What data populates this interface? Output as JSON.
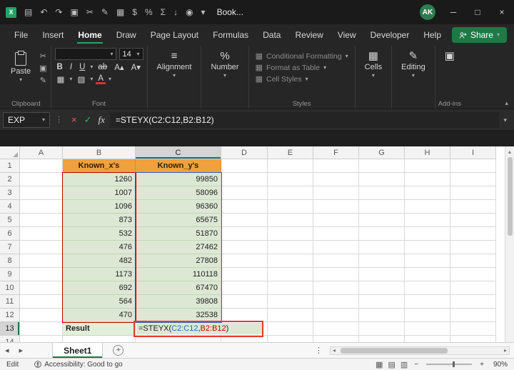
{
  "glyphs": {
    "chevron_down": "▾",
    "chevron_up": "▴"
  },
  "colors": {
    "excel_green": "#21a366",
    "header_orange": "#f0a03e",
    "cell_green": "#dce8d4",
    "result_green": "#e2efda",
    "annotation_red": "#e8392e",
    "range_blue": "#2a66c8",
    "range_red": "#c00000"
  },
  "titlebar": {
    "title": "Book...",
    "avatar_initials": "AK",
    "icons": [
      {
        "name": "excel-icon",
        "glyph": "X",
        "accent": true
      },
      {
        "name": "save-icon",
        "glyph": "▤"
      },
      {
        "name": "undo-icon",
        "glyph": "↶"
      },
      {
        "name": "redo-icon",
        "glyph": "↷"
      },
      {
        "name": "copy-icon",
        "glyph": "▣"
      },
      {
        "name": "cut-icon",
        "glyph": "✂"
      },
      {
        "name": "format-painter-icon",
        "glyph": "✎"
      },
      {
        "name": "merge-center-icon",
        "glyph": "▦"
      },
      {
        "name": "dollar-icon",
        "glyph": "$"
      },
      {
        "name": "percent-icon",
        "glyph": "%"
      },
      {
        "name": "autosum-icon",
        "glyph": "Σ"
      },
      {
        "name": "sort-icon",
        "glyph": "↓"
      },
      {
        "name": "record-macro-icon",
        "glyph": "◉"
      },
      {
        "name": "customize-quick-access-icon",
        "glyph": "▾"
      }
    ],
    "window_controls": {
      "minimize": "─",
      "maximize": "□",
      "close": "×"
    }
  },
  "menu": {
    "tabs": [
      {
        "label": "File"
      },
      {
        "label": "Insert"
      },
      {
        "label": "Home",
        "active": true
      },
      {
        "label": "Draw"
      },
      {
        "label": "Page Layout"
      },
      {
        "label": "Formulas"
      },
      {
        "label": "Data"
      },
      {
        "label": "Review"
      },
      {
        "label": "View"
      },
      {
        "label": "Developer"
      },
      {
        "label": "Help"
      }
    ],
    "share_label": "Share"
  },
  "ribbon": {
    "paste_label": "Paste",
    "clipboard_group": "Clipboard",
    "font_group": "Font",
    "font_size": "14",
    "font_tools": {
      "bold": "B",
      "italic": "I",
      "underline": "U",
      "strike": "ab",
      "grow": "A▴",
      "shrink": "A▾",
      "borders": "▦",
      "fill": "▨",
      "font_color": "A"
    },
    "alignment_icon": "≡",
    "alignment_label": "Alignment",
    "number_icon": "%",
    "number_label": "Number",
    "styles_icon": "▦",
    "conditional_formatting_label": "Conditional Formatting",
    "format_as_table_label": "Format as Table",
    "cell_styles_label": "Cell Styles",
    "styles_group": "Styles",
    "cells_icon": "▦",
    "cells_label": "Cells",
    "editing_icon": "✎",
    "editing_label": "Editing",
    "addins_icon": "▣",
    "addins_group": "Add-ins"
  },
  "formula_bar": {
    "name_box": "EXP",
    "dots_glyph": "⋮",
    "cancel_glyph": "×",
    "enter_glyph": "✓",
    "fx_label": "fx",
    "formula": "=STEYX(C2:C12,B2:B12)"
  },
  "grid": {
    "columns": [
      "A",
      "B",
      "C",
      "D",
      "E",
      "F",
      "G",
      "H",
      "I"
    ],
    "row_count": 14,
    "active_column": "C",
    "active_row": "13",
    "col_headers": {
      "b": "Known_x's",
      "c": "Known_y's"
    },
    "data": [
      {
        "x": "1260",
        "y": "99850"
      },
      {
        "x": "1007",
        "y": "58096"
      },
      {
        "x": "1096",
        "y": "96360"
      },
      {
        "x": "873",
        "y": "65675"
      },
      {
        "x": "532",
        "y": "51870"
      },
      {
        "x": "476",
        "y": "27462"
      },
      {
        "x": "482",
        "y": "27808"
      },
      {
        "x": "1173",
        "y": "110118"
      },
      {
        "x": "692",
        "y": "67470"
      },
      {
        "x": "564",
        "y": "39808"
      },
      {
        "x": "470",
        "y": "32538"
      }
    ],
    "result_label": "Result",
    "formula_parts": [
      {
        "text": "=STEYX(",
        "color": "#1f1f1f"
      },
      {
        "text": "C2:C12",
        "color": "#2a66c8"
      },
      {
        "text": ",",
        "color": "#1f1f1f"
      },
      {
        "text": "B2:B12",
        "color": "#c00000"
      },
      {
        "text": ")",
        "color": "#1f1f1f"
      }
    ]
  },
  "sheet_bar": {
    "prev_glyph": "◂",
    "next_glyph": "▸",
    "tabs": [
      {
        "label": "Sheet1",
        "active": true
      }
    ],
    "add_label": "+",
    "dots_glyph": "⋮"
  },
  "statusbar": {
    "mode": "Edit",
    "accessibility": "Accessibility: Good to go",
    "views": [
      {
        "name": "normal-view-icon",
        "glyph": "▦"
      },
      {
        "name": "page-layout-view-icon",
        "glyph": "▤"
      },
      {
        "name": "page-break-view-icon",
        "glyph": "▥"
      }
    ],
    "zoom_minus": "−",
    "zoom_plus": "+",
    "zoom": "90%"
  }
}
